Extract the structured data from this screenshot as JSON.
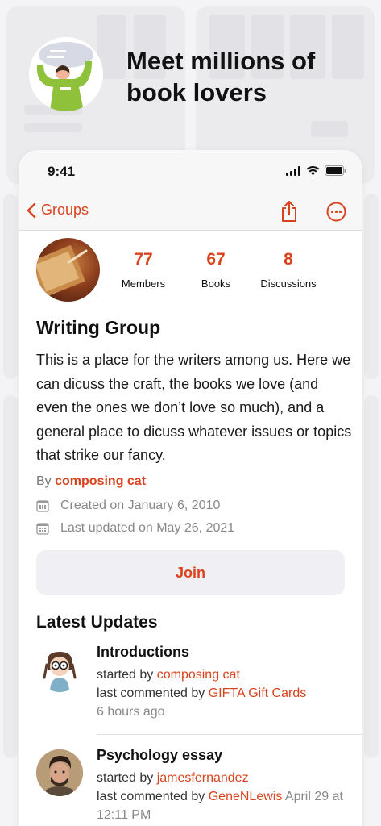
{
  "promo": {
    "title": "Meet millions of book lovers"
  },
  "status_bar": {
    "time": "9:41"
  },
  "nav": {
    "back_label": "Groups"
  },
  "group": {
    "stats": [
      {
        "value": "77",
        "label": "Members"
      },
      {
        "value": "67",
        "label": "Books"
      },
      {
        "value": "8",
        "label": "Discussions"
      }
    ],
    "name": "Writing Group",
    "description": "This is a place for the writers among us. Here we can dicuss the craft, the books we love (and even the ones we don’t love so much), and a general place to dicuss whatever issues or topics that strike our fancy.",
    "by_prefix": "By",
    "author": "composing cat",
    "created": "Created on January 6, 2010",
    "updated": "Last updated on May 26, 2021",
    "join_label": "Join"
  },
  "updates": {
    "section_title": "Latest Updates",
    "items": [
      {
        "title": "Introductions",
        "started_prefix": "started by",
        "started_by": "composing cat",
        "commented_prefix": "last commented by",
        "commented_by": "GIFTA Gift Cards",
        "time": "6 hours ago"
      },
      {
        "title": "Psychology essay",
        "started_prefix": "started by",
        "started_by": "jamesfernandez",
        "commented_prefix": "last commented by",
        "commented_by": "GeneNLewis",
        "time": "April 29 at 12:11 PM"
      }
    ]
  },
  "colors": {
    "accent": "#d9431e",
    "background": "#f4f4f6"
  },
  "icons": {
    "back": "chevron-left-icon",
    "share": "share-icon",
    "more": "more-icon",
    "calendar": "calendar-icon"
  }
}
